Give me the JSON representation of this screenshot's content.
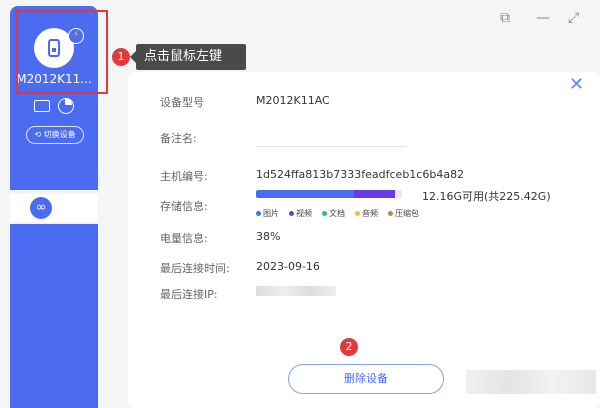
{
  "sidebar": {
    "device_name": "M2012K11...",
    "switch_device": "切换设备"
  },
  "callouts": {
    "step1": "1",
    "step1_text": "点击鼠标左键",
    "step2": "2"
  },
  "panel": {
    "rows": [
      {
        "label": "设备型号",
        "value": "M2012K11AC"
      },
      {
        "label": "备注名:",
        "value": ""
      },
      {
        "label": "主机编号:",
        "value": "1d524ffa813b7333feadfceb1c6b4a82"
      },
      {
        "label": "存储信息:",
        "value": "12.16G可用(共225.42G)"
      },
      {
        "label": "电量信息:",
        "value": "38%"
      },
      {
        "label": "最后连接时间:",
        "value": "2023-09-16"
      },
      {
        "label": "最后连接IP:",
        "value": ""
      }
    ],
    "storage_segments": [
      {
        "name": "图片",
        "fraction": 0.67,
        "color": "#4b6cf0"
      },
      {
        "name": "视频",
        "fraction": 0.28,
        "color": "#6a3be0"
      },
      {
        "name": "文档",
        "fraction": 0.0,
        "color": "#22c08a"
      },
      {
        "name": "音频",
        "fraction": 0.0,
        "color": "#f2c12e"
      },
      {
        "name": "压缩包",
        "fraction": 0.0,
        "color": "#b78a4a"
      }
    ],
    "delete_button": "删除设备"
  },
  "window": {
    "controls": [
      "restore-icon",
      "minimize-icon",
      "expand-icon"
    ]
  },
  "colors": {
    "accent": "#4b6cf0",
    "callout": "#e23a3a"
  }
}
